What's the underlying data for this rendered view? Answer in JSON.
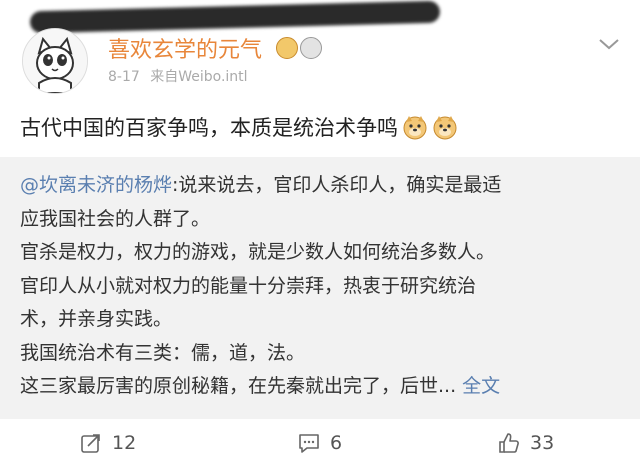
{
  "post": {
    "author": {
      "name": "喜欢玄学的元气",
      "date": "8-17",
      "source": "来自Weibo.intl"
    },
    "text": "古代中国的百家争鸣，本质是统治术争鸣",
    "emojis": [
      "doge-icon",
      "doge-icon"
    ]
  },
  "repost": {
    "mention": "@坎离未济的杨烨",
    "first_line_rest": ":说来说去，官印人杀印人，确实是最适",
    "lines": [
      "应我国社会的人群了。",
      "官杀是权力，权力的游戏，就是少数人如何统治多数人。",
      "官印人从小就对权力的能量十分崇拜，热衷于研究统治",
      "术，并亲身实践。",
      "我国统治术有三类：儒，道，法。"
    ],
    "last_line": "这三家最厉害的原创秘籍，在先秦就出完了，后世...",
    "full_text_link": "全文"
  },
  "actions": {
    "reposts": "12",
    "comments": "6",
    "likes": "33"
  },
  "colors": {
    "username": "#e8863a",
    "link": "#5a7fb0",
    "repost_bg": "#f2f2f2"
  }
}
